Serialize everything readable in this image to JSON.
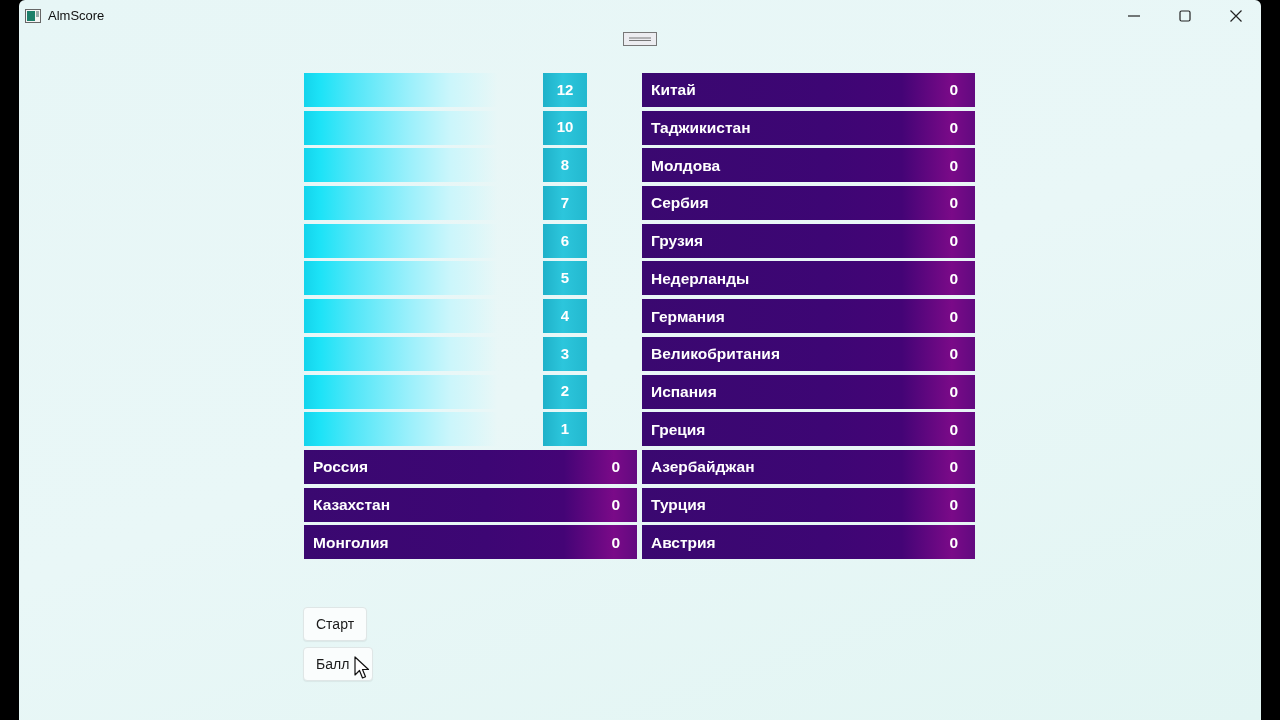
{
  "window": {
    "title": "AlmScore"
  },
  "points": [
    "12",
    "10",
    "8",
    "7",
    "6",
    "5",
    "4",
    "3",
    "2",
    "1"
  ],
  "countries_left": [
    {
      "name": "Россия",
      "score": "0"
    },
    {
      "name": "Казахстан",
      "score": "0"
    },
    {
      "name": "Монголия",
      "score": "0"
    }
  ],
  "countries_right": [
    {
      "name": "Китай",
      "score": "0"
    },
    {
      "name": "Таджикистан",
      "score": "0"
    },
    {
      "name": "Молдова",
      "score": "0"
    },
    {
      "name": "Сербия",
      "score": "0"
    },
    {
      "name": "Грузия",
      "score": "0"
    },
    {
      "name": "Недерланды",
      "score": "0"
    },
    {
      "name": "Германия",
      "score": "0"
    },
    {
      "name": "Великобритания",
      "score": "0"
    },
    {
      "name": "Испания",
      "score": "0"
    },
    {
      "name": "Греция",
      "score": "0"
    },
    {
      "name": "Азербайджан",
      "score": "0"
    },
    {
      "name": "Турция",
      "score": "0"
    },
    {
      "name": "Австрия",
      "score": "0"
    }
  ],
  "buttons": [
    "Старт",
    "Балл"
  ]
}
